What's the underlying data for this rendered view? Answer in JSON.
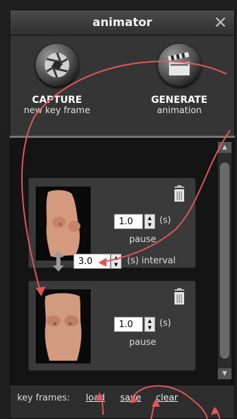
{
  "window": {
    "title": "animator",
    "close_glyph": "✕"
  },
  "actions": {
    "capture": {
      "title": "CAPTURE",
      "subtitle": "new key frame",
      "icon": "camera-aperture-icon"
    },
    "generate": {
      "title": "GENERATE",
      "subtitle": "animation",
      "icon": "clapperboard-icon"
    }
  },
  "frames": [
    {
      "pause_value": "1.0",
      "unit": "(s)",
      "label": "pause"
    },
    {
      "pause_value": "1.0",
      "unit": "(s)",
      "label": "pause"
    }
  ],
  "interval": {
    "value": "3.0",
    "label": "(s) interval"
  },
  "footer": {
    "label": "key frames:",
    "load": "load",
    "save": "save",
    "clear": "clear"
  },
  "colors": {
    "annotation": "#e0575b",
    "panel": "#353535",
    "list_bg": "#141414"
  }
}
